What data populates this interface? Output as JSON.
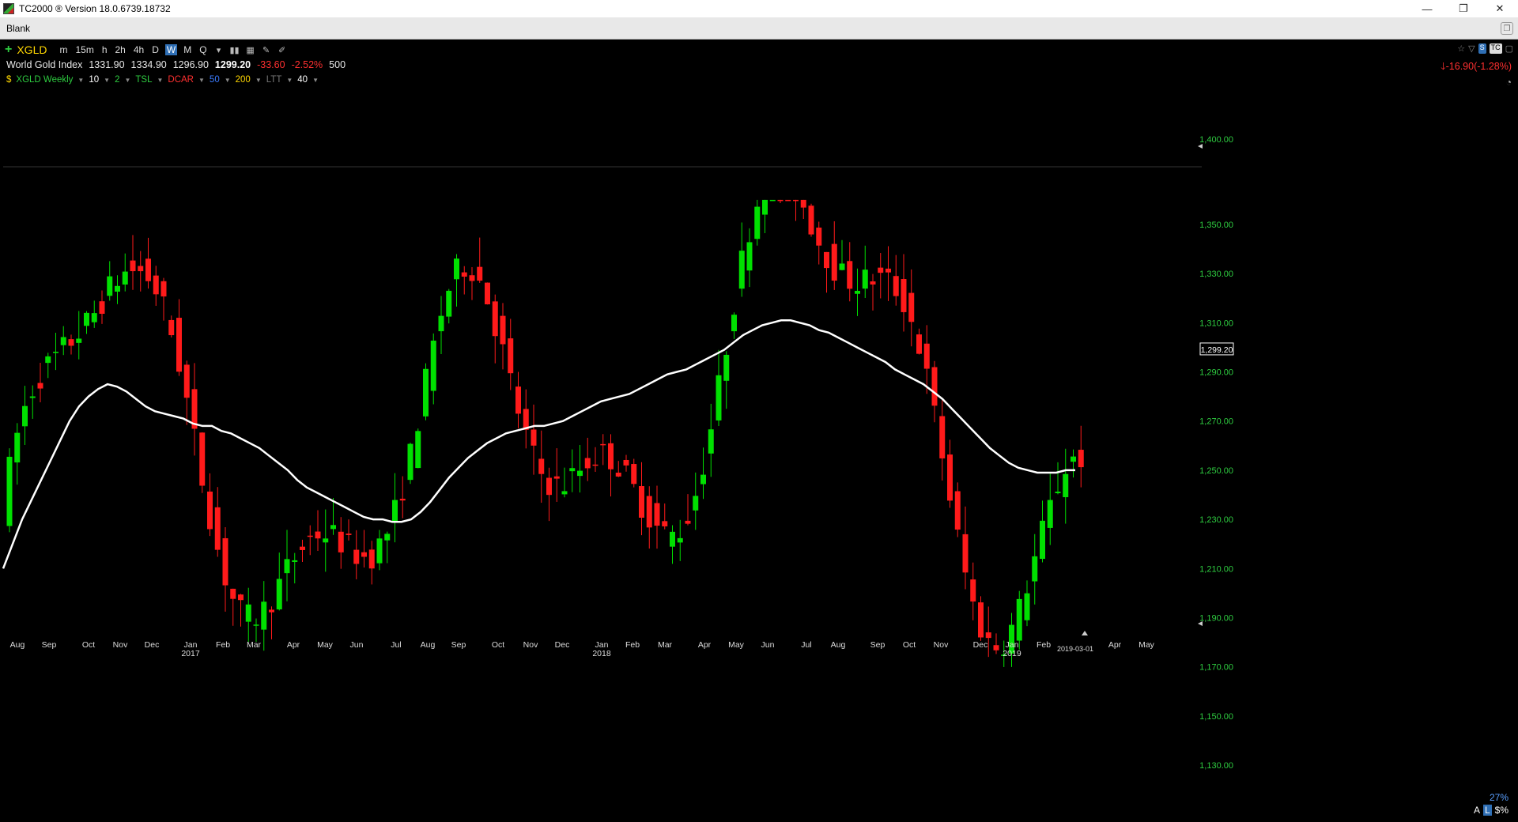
{
  "window": {
    "title": "TC2000 ® Version 18.0.6739.18732",
    "minimize_glyph": "—",
    "restore_glyph": "❐",
    "close_glyph": "✕"
  },
  "tab": {
    "label": "Blank"
  },
  "toolbar": {
    "symbol": "XGLD",
    "timeframes": [
      "m",
      "15m",
      "h",
      "2h",
      "4h",
      "D",
      "W",
      "M",
      "Q"
    ],
    "active_timeframe": "W",
    "menu_caret": "▾"
  },
  "quote": {
    "name": "World Gold Index",
    "open": "1331.90",
    "high": "1334.90",
    "low": "1296.90",
    "close": "1299.20",
    "change": "-33.60",
    "change_pct": "-2.52%",
    "volume": "500",
    "right_change": "-16.90(-1.28%)"
  },
  "indicators": {
    "chart_label": "XGLD Weekly",
    "items": [
      {
        "label": "10",
        "color": "#ffffff"
      },
      {
        "label": "2",
        "color": "#2ecc40"
      },
      {
        "label": "TSL",
        "color": "#2ecc40"
      },
      {
        "label": "DCAR",
        "color": "#ff3030"
      },
      {
        "label": "50",
        "color": "#3a7bff"
      },
      {
        "label": "200",
        "color": "#ffd700"
      },
      {
        "label": "LTT",
        "color": "#777777"
      },
      {
        "label": "40",
        "color": "#ffffff"
      }
    ]
  },
  "status": {
    "zoom": "27%",
    "scale_modes": [
      "A",
      "L",
      "$%"
    ],
    "active_scale": "L",
    "end_date_marker": "2019-03-01"
  },
  "chart_data": {
    "type": "candlestick",
    "title": "XGLD Weekly",
    "up_color": "#00e000",
    "down_color": "#ff1a1a",
    "price_label": "1,299.20",
    "y_ticks": [
      "1,400.00",
      "1,350.00",
      "1,330.00",
      "1,310.00",
      "1,290.00",
      "1,270.00",
      "1,250.00",
      "1,230.00",
      "1,210.00",
      "1,190.00",
      "1,170.00",
      "1,150.00",
      "1,130.00"
    ],
    "x_months": [
      "Aug",
      "Sep",
      "Oct",
      "Nov",
      "Dec",
      "Jan",
      "Feb",
      "Mar",
      "Apr",
      "May",
      "Jun",
      "Jul",
      "Aug",
      "Sep",
      "Oct",
      "Nov",
      "Dec",
      "Jan",
      "Feb",
      "Mar",
      "Apr",
      "May",
      "Jun",
      "Jul",
      "Aug",
      "Sep",
      "Oct",
      "Nov",
      "Dec",
      "Jan",
      "Feb",
      "Apr",
      "May"
    ],
    "x_years": [
      "2017",
      "2018",
      "2019"
    ],
    "ma40": [
      1210,
      1220,
      1230,
      1238,
      1246,
      1254,
      1262,
      1270,
      1276,
      1280,
      1283,
      1285,
      1284,
      1282,
      1279,
      1276,
      1274,
      1273,
      1272,
      1271,
      1269,
      1268,
      1268,
      1266,
      1265,
      1263,
      1261,
      1259,
      1256,
      1253,
      1250,
      1246,
      1243,
      1241,
      1239,
      1237,
      1235,
      1233,
      1231,
      1230,
      1230,
      1229,
      1229,
      1230,
      1233,
      1237,
      1242,
      1247,
      1251,
      1255,
      1258,
      1261,
      1263,
      1265,
      1266,
      1267,
      1268,
      1268,
      1269,
      1270,
      1272,
      1274,
      1276,
      1278,
      1279,
      1280,
      1281,
      1283,
      1285,
      1287,
      1289,
      1290,
      1291,
      1293,
      1295,
      1297,
      1299,
      1302,
      1305,
      1307,
      1309,
      1310,
      1311,
      1311,
      1310,
      1309,
      1307,
      1306,
      1304,
      1302,
      1300,
      1298,
      1296,
      1294,
      1291,
      1289,
      1287,
      1285,
      1282,
      1279,
      1275,
      1271,
      1267,
      1263,
      1259,
      1256,
      1253,
      1251,
      1250,
      1249,
      1249,
      1249,
      1250,
      1250
    ]
  }
}
